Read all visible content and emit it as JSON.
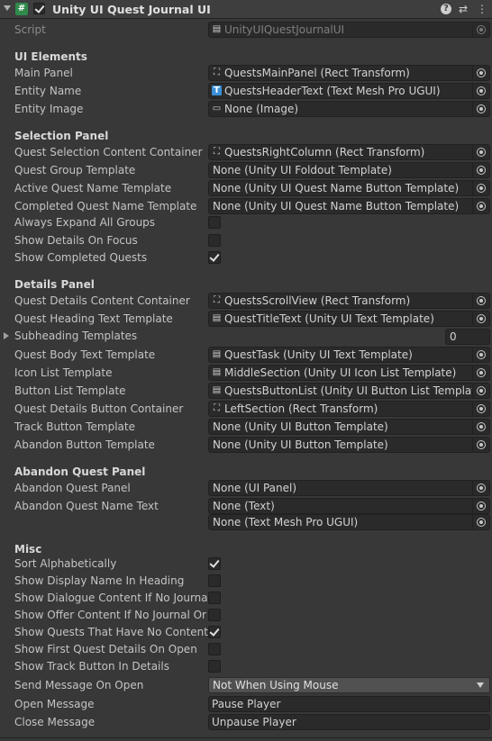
{
  "header": {
    "title": "Unity UI Quest Journal UI",
    "script_icon": "#",
    "enabled": true,
    "icons": [
      "help-icon",
      "preset-icon",
      "more-icon"
    ]
  },
  "script_row": {
    "label": "Script",
    "value": "UnityUIQuestJournalUI"
  },
  "sections": {
    "ui_elements": "UI Elements",
    "selection_panel": "Selection Panel",
    "details_panel": "Details Panel",
    "abandon_quest_panel": "Abandon Quest Panel",
    "misc": "Misc"
  },
  "ui_elements": [
    {
      "label": "Main Panel",
      "value": "QuestsMainPanel (Rect Transform)",
      "icon": "rect-transform-icon"
    },
    {
      "label": "Entity Name",
      "value": "QuestsHeaderText (Text Mesh Pro UGUI)",
      "icon": "text-mesh-pro-icon"
    },
    {
      "label": "Entity Image",
      "value": "None (Image)",
      "icon": "image-icon"
    }
  ],
  "selection_panel": {
    "fields": [
      {
        "label": "Quest Selection Content Container",
        "value": "QuestsRightColumn (Rect Transform)",
        "icon": "rect-transform-icon"
      },
      {
        "label": "Quest Group Template",
        "value": "None (Unity UI Foldout Template)"
      },
      {
        "label": "Active Quest Name Template",
        "value": "None (Unity UI Quest Name Button Template)"
      },
      {
        "label": "Completed Quest Name Template",
        "value": "None (Unity UI Quest Name Button Template)"
      }
    ],
    "toggles": [
      {
        "label": "Always Expand All Groups",
        "checked": false
      },
      {
        "label": "Show Details On Focus",
        "checked": false
      },
      {
        "label": "Show Completed Quests",
        "checked": true
      }
    ]
  },
  "details_panel": {
    "fields_top": [
      {
        "label": "Quest Details Content Container",
        "value": "QuestsScrollView (Rect Transform)",
        "icon": "rect-transform-icon"
      },
      {
        "label": "Quest Heading Text Template",
        "value": "QuestTitleText (Unity UI Text Template)",
        "icon": "script-icon"
      }
    ],
    "subheading": {
      "label": "Subheading Templates",
      "count": "0"
    },
    "fields_bottom": [
      {
        "label": "Quest Body Text Template",
        "value": "QuestTask (Unity UI Text Template)",
        "icon": "script-icon"
      },
      {
        "label": "Icon List Template",
        "value": "MiddleSection (Unity UI Icon List Template)",
        "icon": "script-icon"
      },
      {
        "label": "Button List Template",
        "value": "QuestsButtonList (Unity UI Button List Template)",
        "icon": "script-icon"
      },
      {
        "label": "Quest Details Button Container",
        "value": "LeftSection (Rect Transform)",
        "icon": "rect-transform-icon"
      },
      {
        "label": "Track Button Template",
        "value": "None (Unity UI Button Template)"
      },
      {
        "label": "Abandon Button Template",
        "value": "None (Unity UI Button Template)"
      }
    ]
  },
  "abandon_quest_panel": {
    "panel": {
      "label": "Abandon Quest Panel",
      "value": "None (UI Panel)"
    },
    "name_text": {
      "label": "Abandon Quest Name Text",
      "value": "None (Text)",
      "value2": "None (Text Mesh Pro UGUI)"
    }
  },
  "misc": {
    "toggles": [
      {
        "label": "Sort Alphabetically",
        "checked": true
      },
      {
        "label": "Show Display Name In Heading",
        "checked": false
      },
      {
        "label": "Show Dialogue Content If No Journal",
        "checked": false
      },
      {
        "label": "Show Offer Content If No Journal Or D",
        "checked": false
      },
      {
        "label": "Show Quests That Have No Content",
        "checked": true
      },
      {
        "label": "Show First Quest Details On Open",
        "checked": false
      },
      {
        "label": "Show Track Button In Details",
        "checked": false
      }
    ],
    "send_message": {
      "label": "Send Message On Open",
      "value": "Not When Using Mouse"
    },
    "open_message": {
      "label": "Open Message",
      "value": "Pause Player"
    },
    "close_message": {
      "label": "Close Message",
      "value": "Unpause Player"
    }
  },
  "colors": {
    "background": "#383838",
    "field": "#2a2a2a",
    "script_icon": "#2f8a4b",
    "text": "#c4c4c4"
  }
}
